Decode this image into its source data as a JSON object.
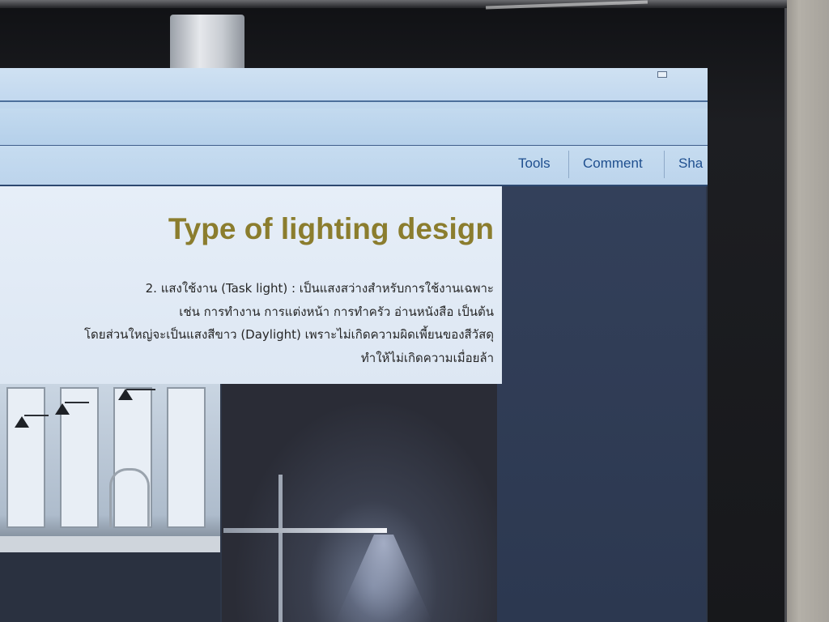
{
  "toolbar": {
    "tools_label": "Tools",
    "comment_label": "Comment",
    "share_label": "Sha"
  },
  "slide": {
    "title": "Type of lighting design",
    "body_lines": [
      "2. แสงใช้งาน (Task light) : เป็นแสงสว่างสำหรับการใช้งานเฉพาะ",
      "เช่น การทำงาน การแต่งหน้า การทำครัว อ่านหนังสือ เป็นต้น",
      "โดยส่วนใหญ่จะเป็นแสงสีขาว (Daylight) เพราะไม่เกิดความผิดเพี้ยนของสีวัสดุ",
      "ทำให้ไม่เกิดความเมื่อยล้า"
    ]
  },
  "colors": {
    "title_color": "#8b7d2e",
    "toolbar_text": "#1f4f8f",
    "toolbar_bg": "#c6dcf0"
  },
  "icons": {
    "minimize": "minimize-icon",
    "scroll": "scroll-handle-icon"
  }
}
